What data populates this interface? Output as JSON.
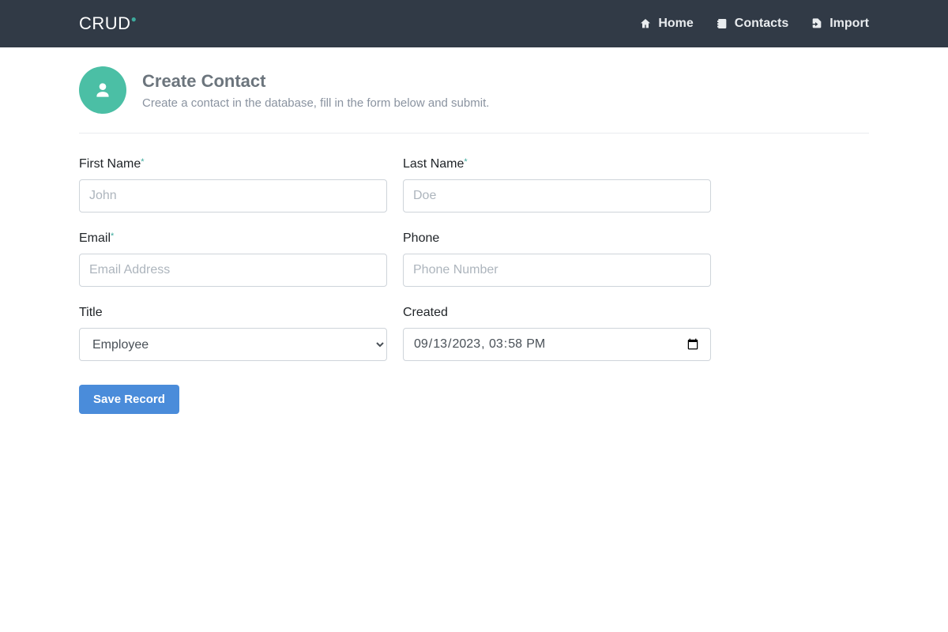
{
  "brand": "CRUD",
  "nav": {
    "home": {
      "label": "Home"
    },
    "contacts": {
      "label": "Contacts"
    },
    "import": {
      "label": "Import"
    }
  },
  "page": {
    "title": "Create Contact",
    "subtitle": "Create a contact in the database, fill in the form below and submit."
  },
  "form": {
    "first_name": {
      "label": "First Name",
      "placeholder": "John",
      "value": ""
    },
    "last_name": {
      "label": "Last Name",
      "placeholder": "Doe",
      "value": ""
    },
    "email": {
      "label": "Email",
      "placeholder": "Email Address",
      "value": ""
    },
    "phone": {
      "label": "Phone",
      "placeholder": "Phone Number",
      "value": ""
    },
    "title": {
      "label": "Title",
      "selected": "Employee"
    },
    "created": {
      "label": "Created",
      "value": "2023-09-13T15:58"
    },
    "submit_label": "Save Record"
  }
}
